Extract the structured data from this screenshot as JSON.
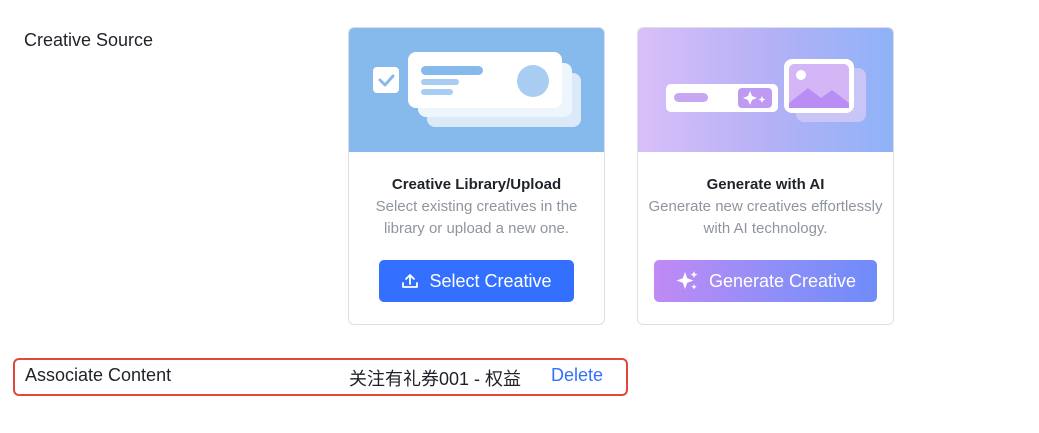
{
  "creative_source": {
    "label": "Creative Source",
    "cards": [
      {
        "title": "Creative Library/Upload",
        "description": "Select existing creatives in the library or upload a new one.",
        "button_label": "Select Creative",
        "button_icon": "upload-icon",
        "button_color": "#3370ff"
      },
      {
        "title": "Generate with AI",
        "description": "Generate new creatives effortlessly with AI technology.",
        "button_label": "Generate Creative",
        "button_icon": "sparkle-icon",
        "button_color": "#a08cf7"
      }
    ]
  },
  "associate_content": {
    "label": "Associate Content",
    "value": "关注有礼券001 - 权益",
    "delete_label": "Delete",
    "highlight_color": "#e0483a"
  }
}
